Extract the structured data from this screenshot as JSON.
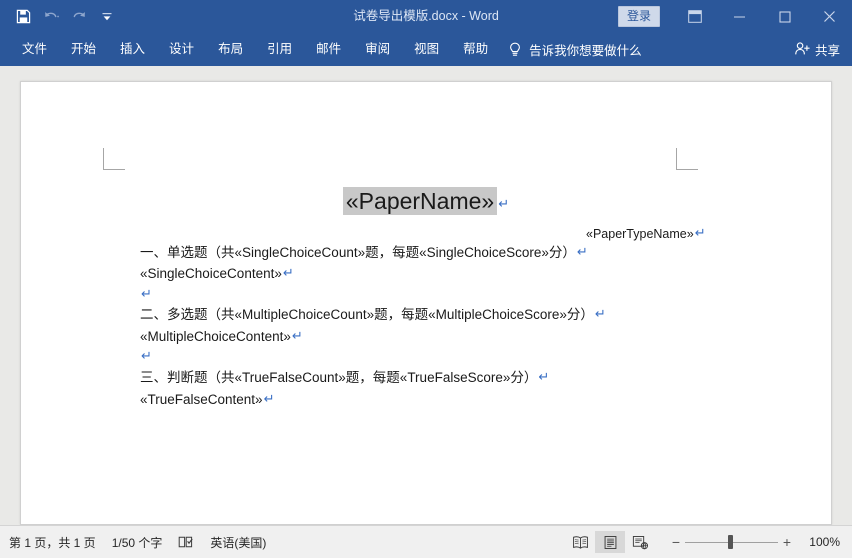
{
  "window": {
    "title": "试卷导出模版.docx  -  Word",
    "signin_label": "登录"
  },
  "quick_access": {
    "save": "save-icon",
    "undo": "undo-icon",
    "redo": "redo-icon",
    "customize": "customize-quick-access-icon"
  },
  "window_controls": {
    "ribbon_display": "ribbon-display-options-icon",
    "minimize": "minimize-icon",
    "maximize": "maximize-icon",
    "close": "close-icon"
  },
  "ribbon": {
    "tabs": [
      {
        "label": "文件"
      },
      {
        "label": "开始"
      },
      {
        "label": "插入"
      },
      {
        "label": "设计"
      },
      {
        "label": "布局"
      },
      {
        "label": "引用"
      },
      {
        "label": "邮件"
      },
      {
        "label": "审阅"
      },
      {
        "label": "视图"
      },
      {
        "label": "帮助"
      }
    ],
    "tell_me": "告诉我你想要做什么",
    "share": "共享"
  },
  "document": {
    "title_field": "«PaperName»",
    "pilcrow": "↵",
    "paper_type_line": "«PaperTypeName»",
    "paragraphs": [
      {
        "id": "p1",
        "text": "一、单选题（共«SingleChoiceCount»题，每题«SingleChoiceScore»分）"
      },
      {
        "id": "p2",
        "text": "«SingleChoiceContent»"
      },
      {
        "id": "p3",
        "text": ""
      },
      {
        "id": "p4",
        "text": "二、多选题（共«MultipleChoiceCount»题，每题«MultipleChoiceScore»分）"
      },
      {
        "id": "p5",
        "text": "«MultipleChoiceContent»"
      },
      {
        "id": "p6",
        "text": ""
      },
      {
        "id": "p7",
        "text": "三、判断题（共«TrueFalseCount»题，每题«TrueFalseScore»分）"
      },
      {
        "id": "p8",
        "text": "«TrueFalseContent»"
      }
    ]
  },
  "status_bar": {
    "page_info": "第 1 页，共 1 页",
    "word_count": "1/50 个字",
    "proofing_icon": "proofing-errors-icon",
    "language": "英语(美国)",
    "views": {
      "read_mode": "read-mode-icon",
      "print_layout": "print-layout-icon",
      "web_layout": "web-layout-icon"
    },
    "zoom_out": "−",
    "zoom_in": "+",
    "zoom_level": "100%"
  },
  "colors": {
    "title_bar": "#2b579a",
    "workspace": "#e9e9e7",
    "page": "#ffffff",
    "status_bar": "#f0f0f0",
    "field_shading": "#c8c8c8",
    "pilcrow": "#3a6fc4"
  }
}
